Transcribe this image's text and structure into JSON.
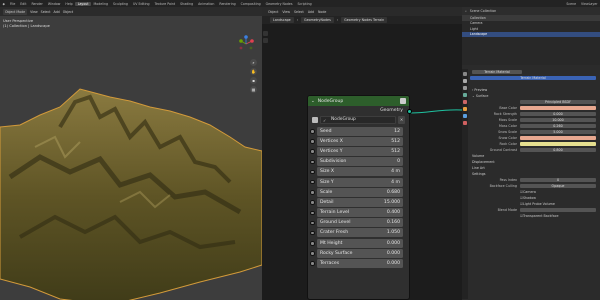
{
  "topbar": {
    "menus": [
      "File",
      "Edit",
      "Render",
      "Window",
      "Help"
    ],
    "workspaces": [
      "Layout",
      "Modeling",
      "Sculpting",
      "UV Editing",
      "Texture Paint",
      "Shading",
      "Animation",
      "Rendering",
      "Compositing",
      "Geometry Nodes",
      "Scripting"
    ],
    "active_workspace": "Layout",
    "scene": "Scene",
    "view_layer": "ViewLayer"
  },
  "viewport": {
    "mode": "Object Mode",
    "menus": [
      "View",
      "Select",
      "Add",
      "Object"
    ],
    "info_line1": "User Perspective",
    "info_line2": "(1) Collection | Landscape"
  },
  "node_editor": {
    "header_items": [
      "Object",
      "View",
      "Select",
      "Add",
      "Node"
    ],
    "breadcrumb": [
      "Landscape",
      "GeometryNodes",
      "Geometry Nodes Terrain"
    ],
    "node": {
      "title": "NodeGroup",
      "output": "Geometry",
      "group_name": "NodeGroup",
      "inputs": [
        {
          "label": "Seed",
          "value": "12"
        },
        {
          "label": "Vertices X",
          "value": "512"
        },
        {
          "label": "Vertices Y",
          "value": "512"
        },
        {
          "label": "Subdivision",
          "value": "0"
        },
        {
          "label": "Size X",
          "value": "4 m"
        },
        {
          "label": "Size Y",
          "value": "4 m"
        },
        {
          "label": "Scale",
          "value": "0.680"
        },
        {
          "label": "Detail",
          "value": "15.000"
        },
        {
          "label": "Terrain Level",
          "value": "0.400"
        },
        {
          "label": "Ground Level",
          "value": "0.160"
        },
        {
          "label": "Crater Fresh",
          "value": "1.050"
        },
        {
          "label": "Mt Height",
          "value": "0.000"
        },
        {
          "label": "Rocky Surface",
          "value": "0.000"
        },
        {
          "label": "Terraces",
          "value": "0.000"
        }
      ]
    }
  },
  "outliner": {
    "search": "Scene Collection",
    "rows": [
      "Collection",
      "Camera",
      "Light",
      "Landscape"
    ],
    "active": "Landscape"
  },
  "properties": {
    "object": "Terrain Material",
    "material_slot": "Terrain Material",
    "sections": [
      "Preview",
      "Surface"
    ],
    "surface_type": "Principled BSDF",
    "fields": [
      {
        "label": "Base Color",
        "value": "",
        "kind": "peach"
      },
      {
        "label": "Rock Strength",
        "value": "0.000"
      },
      {
        "label": "Moss Scale",
        "value": "10.000"
      },
      {
        "label": "Moss Color",
        "value": "0.260"
      },
      {
        "label": "Snow Scale",
        "value": "5.000"
      },
      {
        "label": "Snow Color",
        "value": "",
        "kind": "peach"
      },
      {
        "label": "Rock Color",
        "value": "",
        "kind": "yellow"
      },
      {
        "label": "Ground Contrast",
        "value": "0.800"
      }
    ],
    "subsections": [
      "Volume",
      "Displacement",
      "Line Art",
      "Settings"
    ],
    "pass_index_label": "Pass Index",
    "pass_index": "0",
    "backface": "Backface Culling",
    "shadow_mode": "Opaque",
    "blend_mode": "Blend Mode",
    "checks": [
      "Camera",
      "Shadow",
      "Light Probe Volume"
    ],
    "transparent_backface": "Transparent Backface",
    "colors": {
      "accent": "#4772b3",
      "node_header": "#2d5e2b",
      "geometry_socket": "#1fc2a0"
    }
  }
}
